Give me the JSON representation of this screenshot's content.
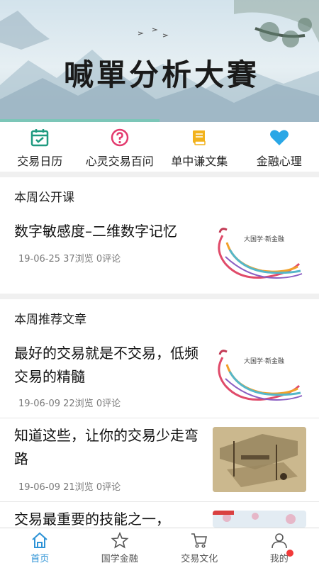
{
  "banner": {
    "title": "喊單分析大賽"
  },
  "quicknav": [
    {
      "label": "交易日历",
      "icon": "calendar-check-icon",
      "color": "#1f9a80"
    },
    {
      "label": "心灵交易百问",
      "icon": "question-circle-icon",
      "color": "#e33a6e"
    },
    {
      "label": "单中谦文集",
      "icon": "book-icon",
      "color": "#f2b21c"
    },
    {
      "label": "金融心理",
      "icon": "heart-icon",
      "color": "#2aa7e6"
    }
  ],
  "sections": {
    "open_course": {
      "heading": "本周公开课",
      "items": [
        {
          "title": "数字敏感度–二维数字记忆",
          "meta": "19-06-25 37浏览 0评论",
          "thumb_caption": "大国学·新金融"
        }
      ]
    },
    "recommended": {
      "heading": "本周推荐文章",
      "items": [
        {
          "title": "最好的交易就是不交易，低频交易的精髓",
          "meta": "19-06-09 22浏览 0评论",
          "thumb_caption": "大国学·新金融"
        },
        {
          "title": "知道这些，让你的交易少走弯路",
          "meta": "19-06-09 21浏览 0评论"
        },
        {
          "title": "交易最重要的技能之一，"
        }
      ]
    }
  },
  "tabbar": [
    {
      "label": "首页",
      "icon": "home-icon",
      "active": true
    },
    {
      "label": "国学金融",
      "icon": "star-icon",
      "active": false
    },
    {
      "label": "交易文化",
      "icon": "cart-icon",
      "active": false
    },
    {
      "label": "我的",
      "icon": "user-icon",
      "active": false
    }
  ],
  "colors": {
    "accent": "#2e93d6",
    "badge": "#f23a3a"
  }
}
